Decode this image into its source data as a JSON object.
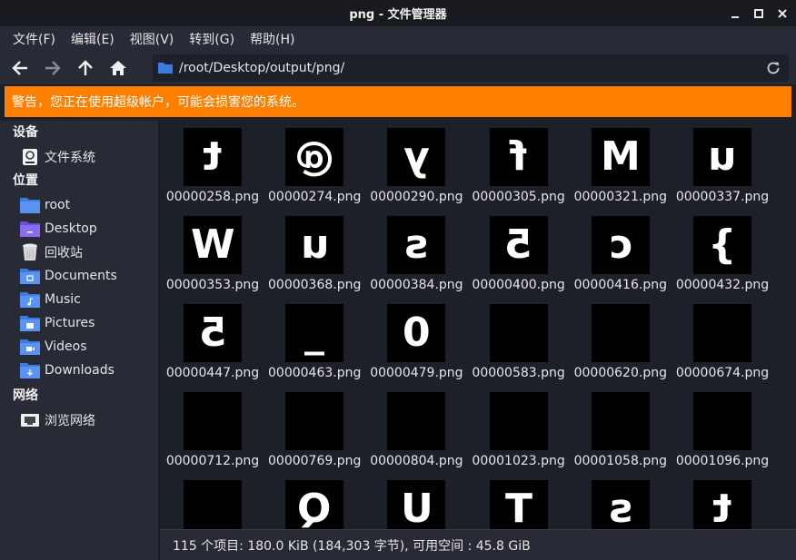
{
  "window": {
    "title": "png - 文件管理器"
  },
  "menu": [
    {
      "label": "文件(F)"
    },
    {
      "label": "编辑(E)"
    },
    {
      "label": "视图(V)"
    },
    {
      "label": "转到(G)"
    },
    {
      "label": "帮助(H)"
    }
  ],
  "location": {
    "path": "/root/Desktop/output/png/"
  },
  "warning": {
    "text": "警告，您正在使用超级帐户，可能会损害您的系统。"
  },
  "sidebar": {
    "devices_label": "设备",
    "devices": [
      {
        "label": "文件系统",
        "icon": "drive-icon"
      }
    ],
    "places_label": "位置",
    "places": [
      {
        "label": "root",
        "icon": "folder-home-icon"
      },
      {
        "label": "Desktop",
        "icon": "folder-desktop-icon"
      },
      {
        "label": "回收站",
        "icon": "trash-icon"
      },
      {
        "label": "Documents",
        "icon": "folder-documents-icon"
      },
      {
        "label": "Music",
        "icon": "folder-music-icon"
      },
      {
        "label": "Pictures",
        "icon": "folder-pictures-icon"
      },
      {
        "label": "Videos",
        "icon": "folder-videos-icon"
      },
      {
        "label": "Downloads",
        "icon": "folder-downloads-icon"
      }
    ],
    "network_label": "网络",
    "network": [
      {
        "label": "浏览网络",
        "icon": "network-icon"
      }
    ]
  },
  "files": [
    {
      "name": "00000258.png",
      "glyph": "t"
    },
    {
      "name": "00000274.png",
      "glyph": "@"
    },
    {
      "name": "00000290.png",
      "glyph": "y"
    },
    {
      "name": "00000305.png",
      "glyph": "f"
    },
    {
      "name": "00000321.png",
      "glyph": "M"
    },
    {
      "name": "00000337.png",
      "glyph": "u"
    },
    {
      "name": "00000353.png",
      "glyph": "W"
    },
    {
      "name": "00000368.png",
      "glyph": "u"
    },
    {
      "name": "00000384.png",
      "glyph": "s"
    },
    {
      "name": "00000400.png",
      "glyph": "5"
    },
    {
      "name": "00000416.png",
      "glyph": "c"
    },
    {
      "name": "00000432.png",
      "glyph": "}"
    },
    {
      "name": "00000447.png",
      "glyph": "5"
    },
    {
      "name": "00000463.png",
      "glyph": "_"
    },
    {
      "name": "00000479.png",
      "glyph": "0"
    },
    {
      "name": "00000583.png",
      "glyph": ""
    },
    {
      "name": "00000620.png",
      "glyph": ""
    },
    {
      "name": "00000674.png",
      "glyph": ""
    },
    {
      "name": "00000712.png",
      "glyph": ""
    },
    {
      "name": "00000769.png",
      "glyph": ""
    },
    {
      "name": "00000804.png",
      "glyph": ""
    },
    {
      "name": "00001023.png",
      "glyph": ""
    },
    {
      "name": "00001058.png",
      "glyph": ""
    },
    {
      "name": "00001096.png",
      "glyph": ""
    },
    {
      "name": "",
      "glyph": ""
    },
    {
      "name": "",
      "glyph": "Q"
    },
    {
      "name": "",
      "glyph": "U"
    },
    {
      "name": "",
      "glyph": "T"
    },
    {
      "name": "",
      "glyph": "s"
    },
    {
      "name": "",
      "glyph": "t"
    }
  ],
  "status": {
    "text": "115 个项目: 180.0 KiB (184,303 字节), 可用空间 : 45.8 GiB"
  },
  "colors": {
    "warning": "#ff7f00",
    "folder": "#3d7be0",
    "background": "#1e2029",
    "panel": "#282a36"
  }
}
